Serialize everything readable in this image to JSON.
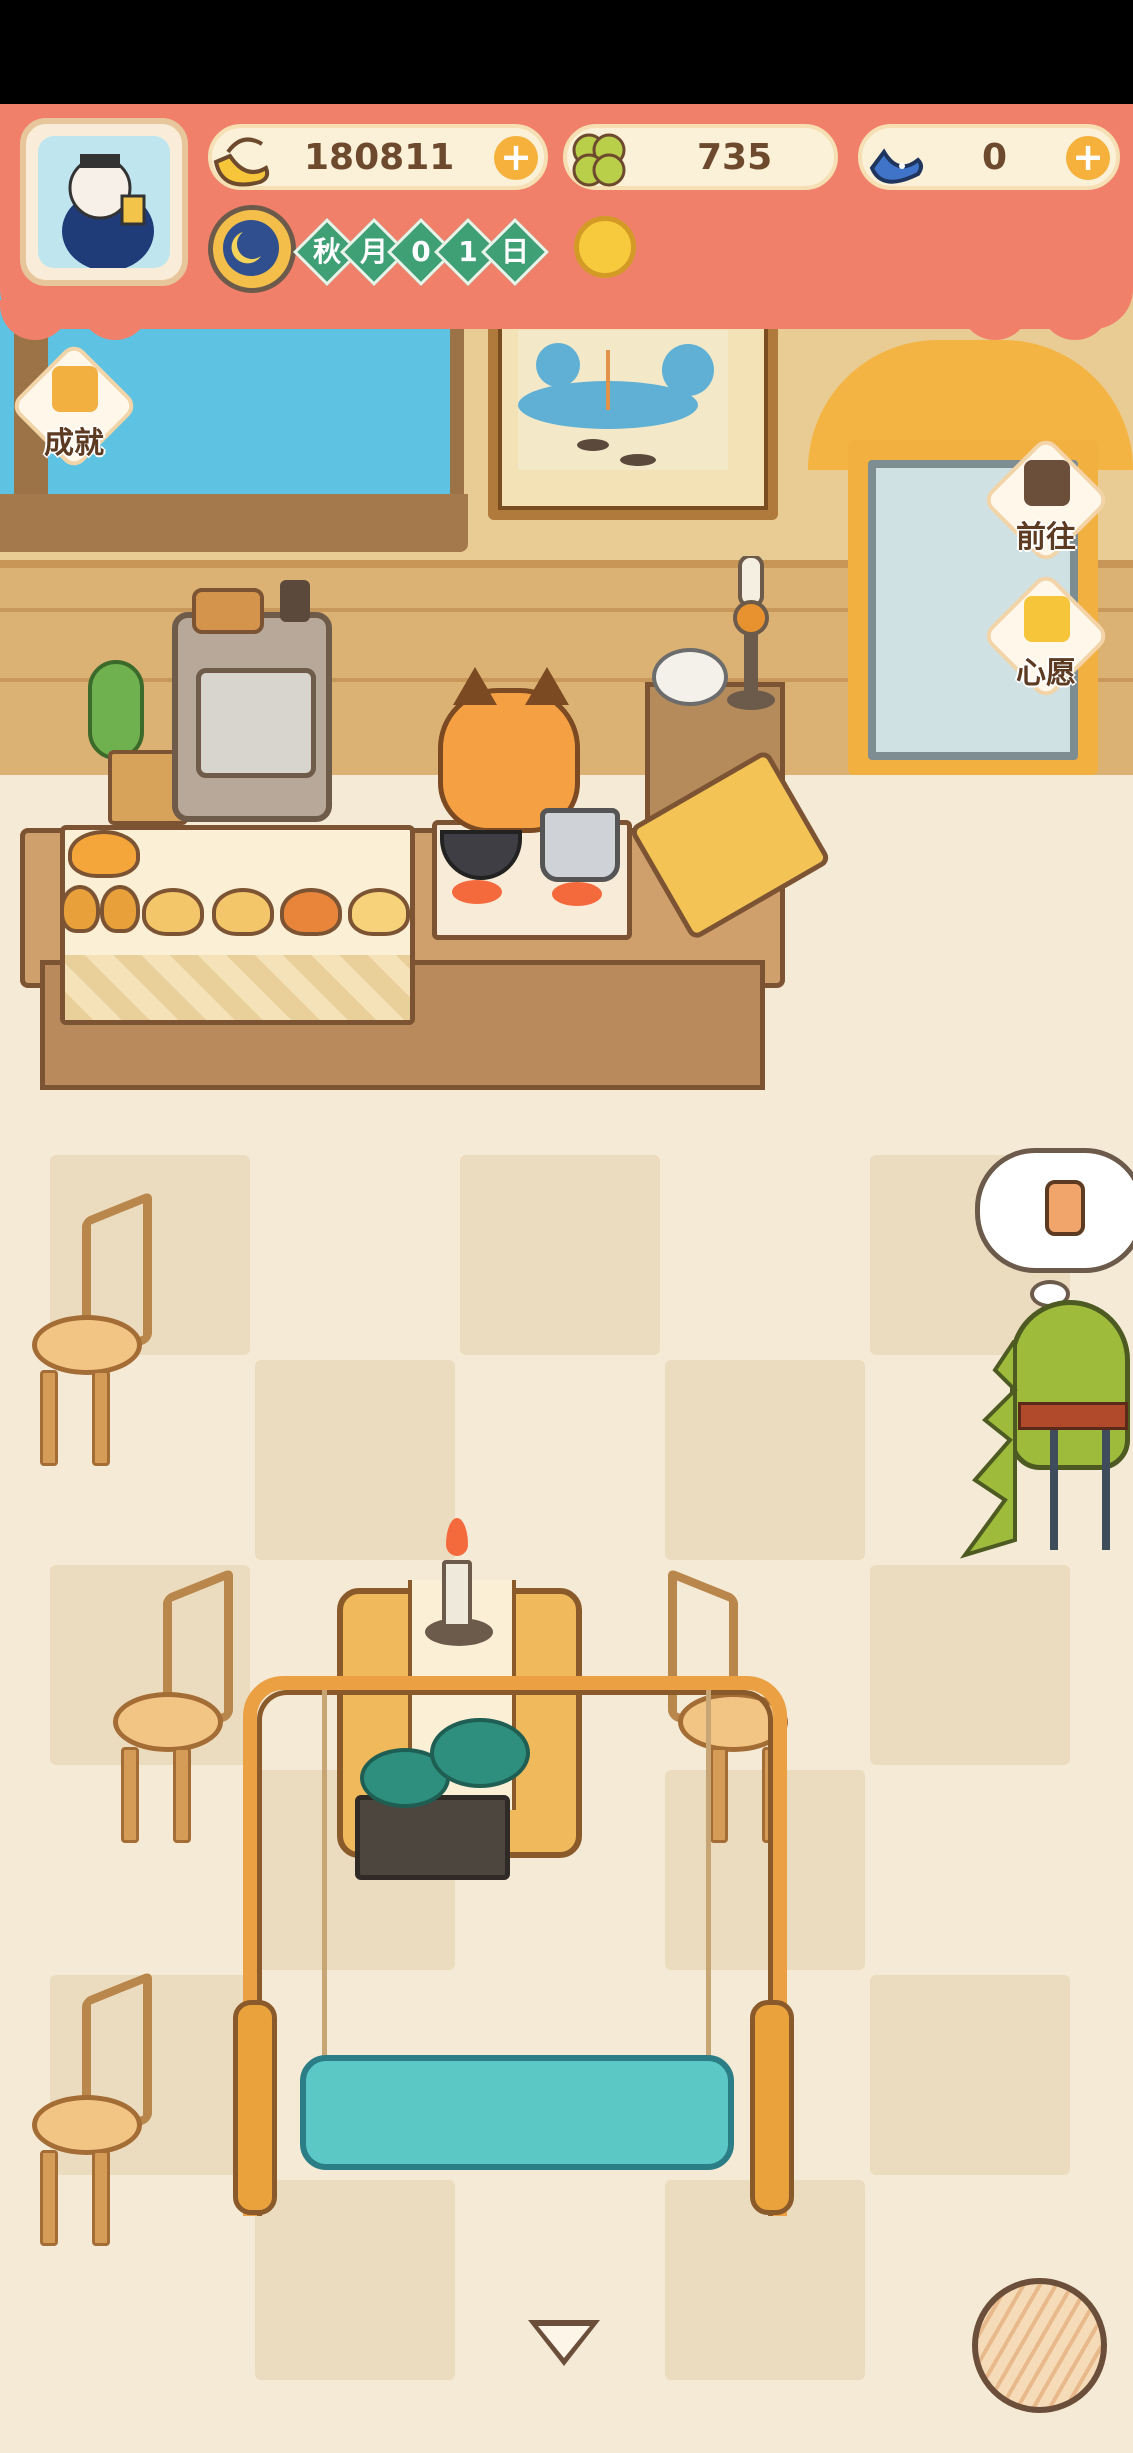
{
  "currencies": {
    "bananas": {
      "value": "180811",
      "icon": "banana-icon",
      "has_plus": true
    },
    "clovers": {
      "value": "735",
      "icon": "clover-icon",
      "has_plus": false
    },
    "blue_bananas": {
      "value": "0",
      "icon": "blue-banana-icon",
      "has_plus": true
    }
  },
  "date": {
    "chars": [
      "秋",
      "月",
      "0",
      "1",
      "日"
    ],
    "weather_icon": "sun-icon"
  },
  "side_buttons": {
    "achievements": "成就",
    "go_to": "前往",
    "wish": "心愿"
  },
  "colors": {
    "banner": "#f0806a",
    "date_chip": "#3f9f75",
    "plus_button": "#f5b13b"
  }
}
